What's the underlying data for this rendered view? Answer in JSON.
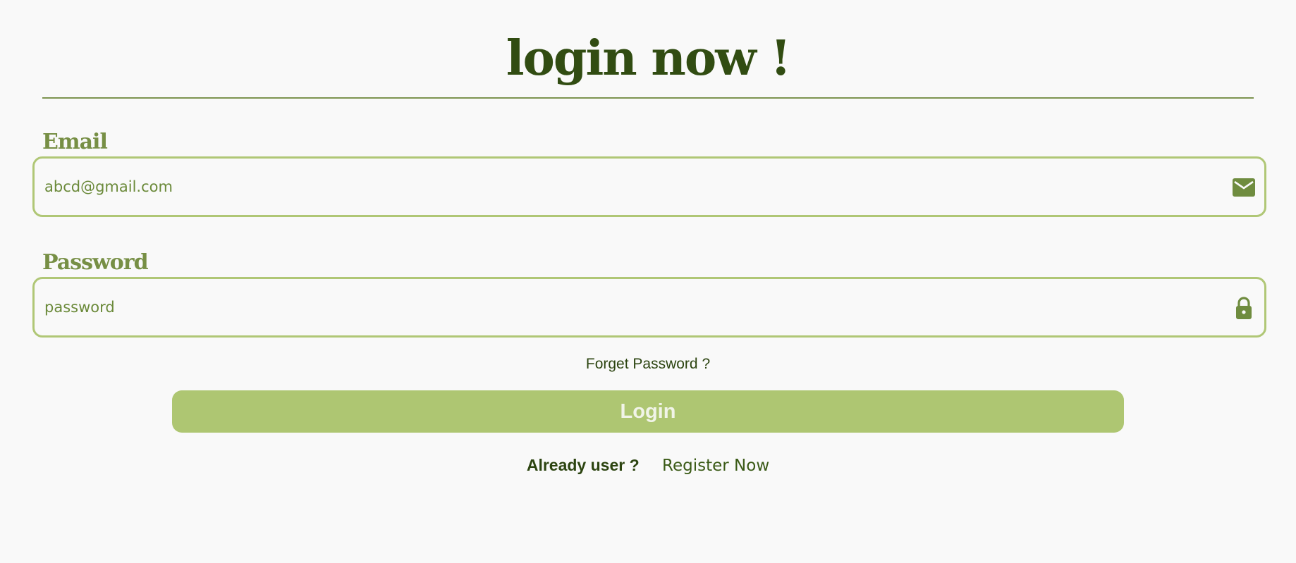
{
  "header": {
    "title": "login now !"
  },
  "form": {
    "email": {
      "label": "Email",
      "placeholder": "abcd@gmail.com",
      "icon": "envelope-icon"
    },
    "password": {
      "label": "Password",
      "placeholder": "password",
      "icon": "lock-icon"
    },
    "forget_link": "Forget Password ?",
    "submit_label": "Login"
  },
  "footer": {
    "prompt": "Already user ?",
    "register_link": "Register Now"
  },
  "colors": {
    "background": "#f9f9f9",
    "title": "#314c12",
    "label": "#778f45",
    "field_border": "#b0c776",
    "icon": "#6f8c3f",
    "button": "#aec672",
    "button_text": "#f1f4e8"
  }
}
